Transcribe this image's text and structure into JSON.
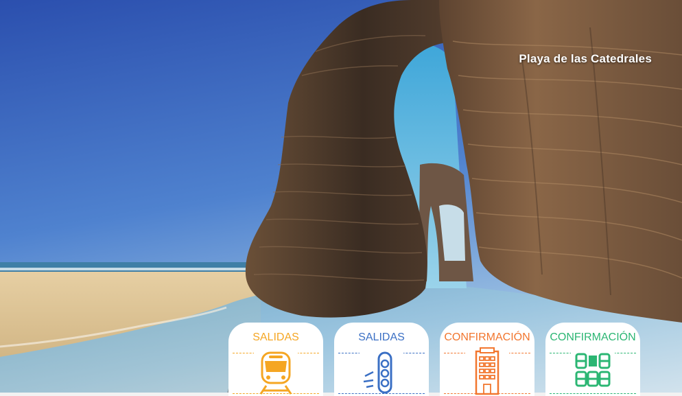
{
  "photo": {
    "caption": "Playa de las Catedrales"
  },
  "badges": [
    {
      "title": "SALIDAS",
      "icon": "train-icon",
      "color": "#f5a623"
    },
    {
      "title": "SALIDAS",
      "icon": "bus-icon",
      "color": "#3a6fc4"
    },
    {
      "title": "CONFIRMACIÓN",
      "icon": "hotel-icon",
      "color": "#f2762e"
    },
    {
      "title": "CONFIRMACIÓN",
      "icon": "seats-icon",
      "color": "#2bb673"
    }
  ]
}
